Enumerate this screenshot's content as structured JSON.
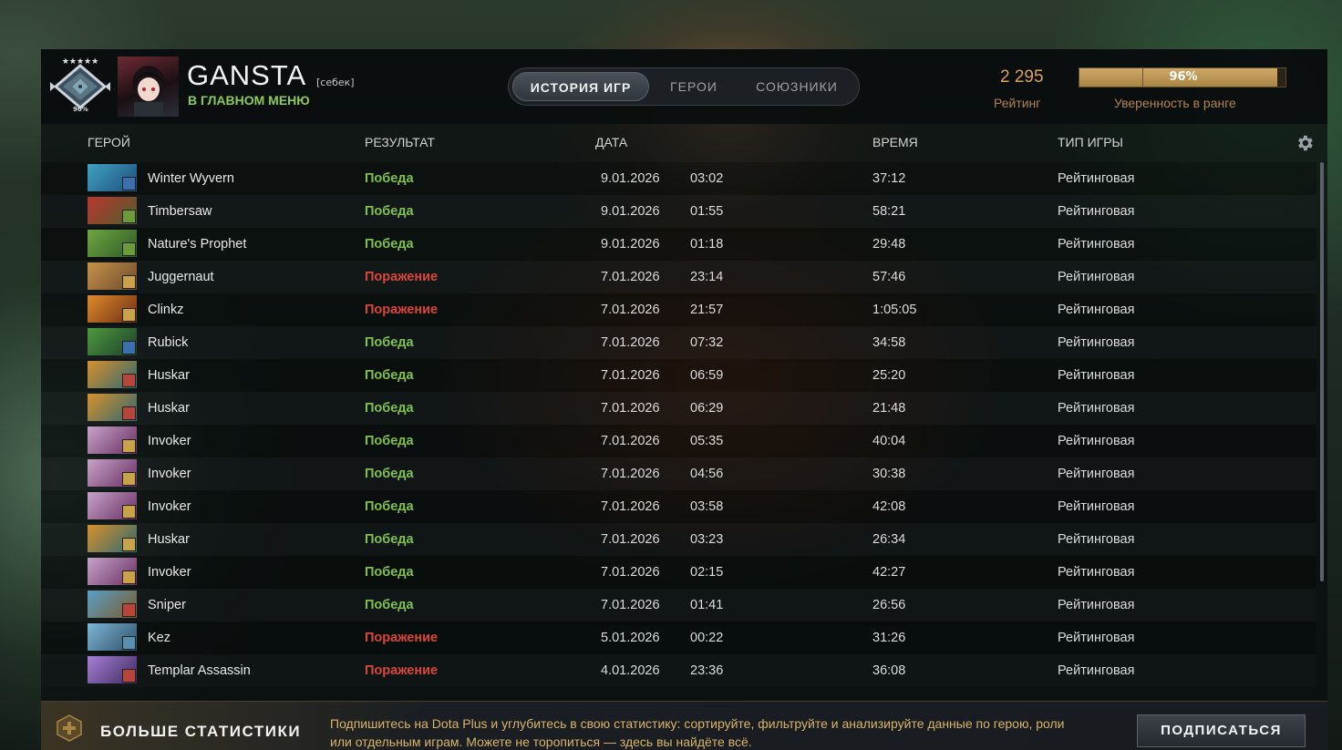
{
  "player": {
    "name": "GANSTA",
    "tag": "[себек]",
    "status": "В ГЛАВНОМ МЕНЮ",
    "rank_percent": "90%"
  },
  "tabs": [
    {
      "label": "ИСТОРИЯ ИГР",
      "active": true
    },
    {
      "label": "ГЕРОИ",
      "active": false
    },
    {
      "label": "СОЮЗНИКИ",
      "active": false
    }
  ],
  "rating": {
    "value": "2 295",
    "label": "Рейтинг"
  },
  "confidence": {
    "percent_text": "96%",
    "fraction": 0.96,
    "label": "Уверенность в ранге"
  },
  "columns": {
    "hero": "ГЕРОЙ",
    "result": "РЕЗУЛЬТАТ",
    "date": "ДАТА",
    "duration": "ВРЕМЯ",
    "type": "ТИП ИГРЫ"
  },
  "matches": [
    {
      "hero": "Winter Wyvern",
      "result": "Победа",
      "win": true,
      "date": "9.01.2026",
      "time": "03:02",
      "duration": "37:12",
      "type": "Рейтинговая",
      "colors": [
        "#3fa1c4",
        "#1f4f7a"
      ],
      "role_color": "#3b6fb0"
    },
    {
      "hero": "Timbersaw",
      "result": "Победа",
      "win": true,
      "date": "9.01.2026",
      "time": "01:55",
      "duration": "58:21",
      "type": "Рейтинговая",
      "colors": [
        "#b9372f",
        "#4e5d2e"
      ],
      "role_color": "#6d9a3a"
    },
    {
      "hero": "Nature's Prophet",
      "result": "Победа",
      "win": true,
      "date": "9.01.2026",
      "time": "01:18",
      "duration": "29:48",
      "type": "Рейтинговая",
      "colors": [
        "#6fa640",
        "#2e5a26"
      ],
      "role_color": "#6d9a3a"
    },
    {
      "hero": "Juggernaut",
      "result": "Поражение",
      "win": false,
      "date": "7.01.2026",
      "time": "23:14",
      "duration": "57:46",
      "type": "Рейтинговая",
      "colors": [
        "#c8934a",
        "#6b4a2c"
      ],
      "role_color": "#c9a34a"
    },
    {
      "hero": "Clinkz",
      "result": "Поражение",
      "win": false,
      "date": "7.01.2026",
      "time": "21:57",
      "duration": "1:05:05",
      "type": "Рейтинговая",
      "colors": [
        "#e08a2a",
        "#6b2e14"
      ],
      "role_color": "#c9a34a"
    },
    {
      "hero": "Rubick",
      "result": "Победа",
      "win": true,
      "date": "7.01.2026",
      "time": "07:32",
      "duration": "34:58",
      "type": "Рейтинговая",
      "colors": [
        "#4e9a3e",
        "#1d3e2a"
      ],
      "role_color": "#3b6fb0"
    },
    {
      "hero": "Huskar",
      "result": "Победа",
      "win": true,
      "date": "7.01.2026",
      "time": "06:59",
      "duration": "25:20",
      "type": "Рейтинговая",
      "colors": [
        "#d8902c",
        "#2f6a70"
      ],
      "role_color": "#b8453b"
    },
    {
      "hero": "Huskar",
      "result": "Победа",
      "win": true,
      "date": "7.01.2026",
      "time": "06:29",
      "duration": "21:48",
      "type": "Рейтинговая",
      "colors": [
        "#d8902c",
        "#2f6a70"
      ],
      "role_color": "#b8453b"
    },
    {
      "hero": "Invoker",
      "result": "Победа",
      "win": true,
      "date": "7.01.2026",
      "time": "05:35",
      "duration": "40:04",
      "type": "Рейтинговая",
      "colors": [
        "#c6a3c9",
        "#6a2f62"
      ],
      "role_color": "#c9a34a"
    },
    {
      "hero": "Invoker",
      "result": "Победа",
      "win": true,
      "date": "7.01.2026",
      "time": "04:56",
      "duration": "30:38",
      "type": "Рейтинговая",
      "colors": [
        "#c6a3c9",
        "#6a2f62"
      ],
      "role_color": "#c9a34a"
    },
    {
      "hero": "Invoker",
      "result": "Победа",
      "win": true,
      "date": "7.01.2026",
      "time": "03:58",
      "duration": "42:08",
      "type": "Рейтинговая",
      "colors": [
        "#c6a3c9",
        "#6a2f62"
      ],
      "role_color": "#c9a34a"
    },
    {
      "hero": "Huskar",
      "result": "Победа",
      "win": true,
      "date": "7.01.2026",
      "time": "03:23",
      "duration": "26:34",
      "type": "Рейтинговая",
      "colors": [
        "#d8902c",
        "#2f6a70"
      ],
      "role_color": "#c9a34a"
    },
    {
      "hero": "Invoker",
      "result": "Победа",
      "win": true,
      "date": "7.01.2026",
      "time": "02:15",
      "duration": "42:27",
      "type": "Рейтинговая",
      "colors": [
        "#c6a3c9",
        "#6a2f62"
      ],
      "role_color": "#c9a34a"
    },
    {
      "hero": "Sniper",
      "result": "Победа",
      "win": true,
      "date": "7.01.2026",
      "time": "01:41",
      "duration": "26:56",
      "type": "Рейтинговая",
      "colors": [
        "#5aa0c8",
        "#7a5b2a"
      ],
      "role_color": "#b8453b"
    },
    {
      "hero": "Kez",
      "result": "Поражение",
      "win": false,
      "date": "5.01.2026",
      "time": "00:22",
      "duration": "31:26",
      "type": "Рейтинговая",
      "colors": [
        "#7fb6d6",
        "#2c4f66"
      ],
      "role_color": "#5a8fb0"
    },
    {
      "hero": "Templar Assassin",
      "result": "Поражение",
      "win": false,
      "date": "4.01.2026",
      "time": "23:36",
      "duration": "36:08",
      "type": "Рейтинговая",
      "colors": [
        "#a77fd6",
        "#3d2a5e"
      ],
      "role_color": "#b8453b"
    }
  ],
  "footer": {
    "title": "БОЛЬШЕ СТАТИСТИКИ",
    "text": "Подпишитесь на Dota Plus и углубитесь в свою статистику: сортируйте, фильтруйте и анализируйте данные по герою, роли или отдельным играм. Можете не торопиться — здесь вы найдёте всё.",
    "button": "ПОДПИСАТЬСЯ"
  },
  "icons": {
    "rank": "rank-medal-icon",
    "settings": "gear-icon",
    "dota_plus": "dota-plus-icon"
  }
}
